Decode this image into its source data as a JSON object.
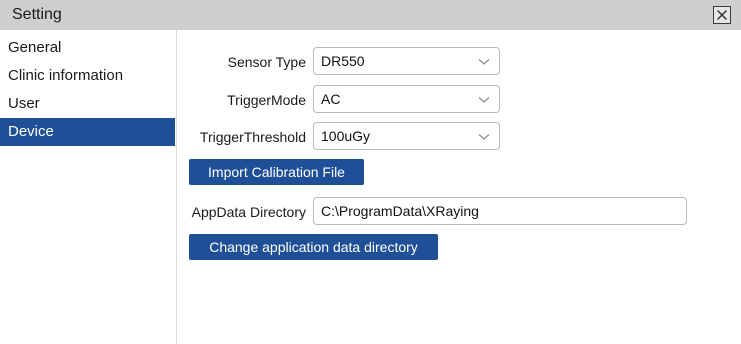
{
  "window": {
    "title": "Setting",
    "close_icon": "close-icon"
  },
  "sidebar": {
    "items": [
      {
        "label": "General",
        "active": false
      },
      {
        "label": "Clinic information",
        "active": false
      },
      {
        "label": "User",
        "active": false
      },
      {
        "label": "Device",
        "active": true
      }
    ]
  },
  "device": {
    "sensor_type": {
      "label": "Sensor Type",
      "value": "DR550"
    },
    "trigger_mode": {
      "label": "TriggerMode",
      "value": "AC"
    },
    "trigger_threshold": {
      "label": "TriggerThreshold",
      "value": "100uGy"
    },
    "import_calibration_label": "Import Calibration File",
    "appdata_directory": {
      "label": "AppData Directory",
      "value": "C:\\ProgramData\\XRaying"
    },
    "change_directory_label": "Change application data directory"
  },
  "colors": {
    "accent": "#1f5097",
    "titlebar": "#cfcfcf",
    "border": "#b9b9b9"
  }
}
